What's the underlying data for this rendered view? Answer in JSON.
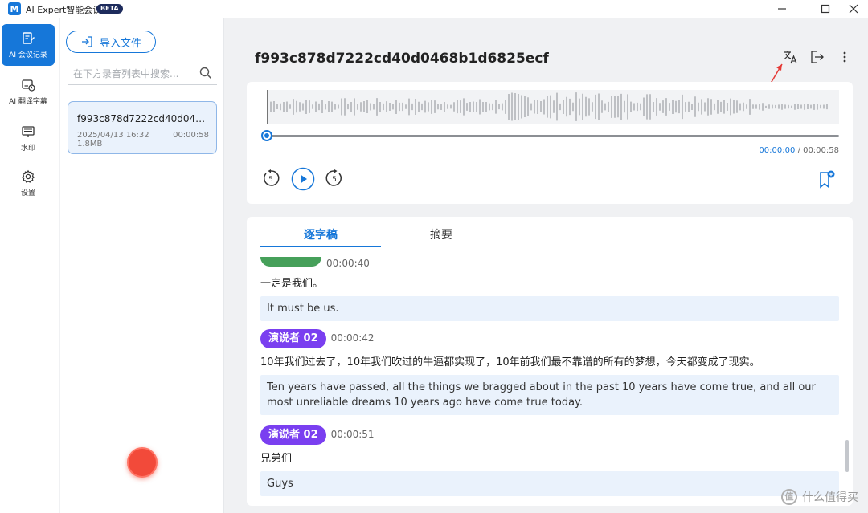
{
  "window": {
    "logo_glyph": "M",
    "app_title": "AI Expert智能会议",
    "beta_badge": "BETA"
  },
  "nav": {
    "items": [
      {
        "label": "AI 会议记录",
        "icon": "document-edit-icon",
        "active": true
      },
      {
        "label": "AI 翻译字幕",
        "icon": "subtitle-clock-icon",
        "active": false
      },
      {
        "label": "水印",
        "icon": "watermark-screen-icon",
        "active": false
      },
      {
        "label": "设置",
        "icon": "gear-icon",
        "active": false
      }
    ]
  },
  "files": {
    "import_label": "导入文件",
    "search_placeholder": "在下方录音列表中搜索...",
    "items": [
      {
        "name": "f993c878d7222cd40d0468b1...",
        "date": "2025/04/13 16:32 1.8MB",
        "duration": "00:00:58"
      }
    ]
  },
  "main": {
    "title": "f993c878d7222cd40d0468b1d6825ecf",
    "player": {
      "current_time": "00:00:00",
      "separator": " / ",
      "total_time": "00:00:58",
      "skip_back_label": "5",
      "skip_forward_label": "5",
      "progress": 0.0
    },
    "tabs": [
      {
        "label": "逐字稿",
        "active": true
      },
      {
        "label": "摘要",
        "active": false
      }
    ],
    "transcript": [
      {
        "speaker": "",
        "time": "00:00:40",
        "zh": "一定是我们。",
        "en": "It must be us.",
        "color": "#46a05a"
      },
      {
        "speaker": "演说者 02",
        "time": "00:00:42",
        "zh": "10年我们过去了，10年我们吹过的牛逼都实现了，10年前我们最不靠谱的所有的梦想，今天都变成了现实。",
        "en": "Ten years have passed, all the things we bragged about in the past 10 years have come true, and all our most unreliable dreams 10 years ago have come true today.",
        "color": "#7a3ff0"
      },
      {
        "speaker": "演说者 02",
        "time": "00:00:51",
        "zh": "兄弟们",
        "en": "Guys",
        "color": "#7a3ff0"
      }
    ]
  },
  "watermark": {
    "glyph": "值",
    "text": "什么值得买"
  },
  "colors": {
    "accent": "#1677d9",
    "record": "#f24a3a",
    "speaker_purple": "#7a3ff0",
    "speaker_green": "#46a05a"
  }
}
